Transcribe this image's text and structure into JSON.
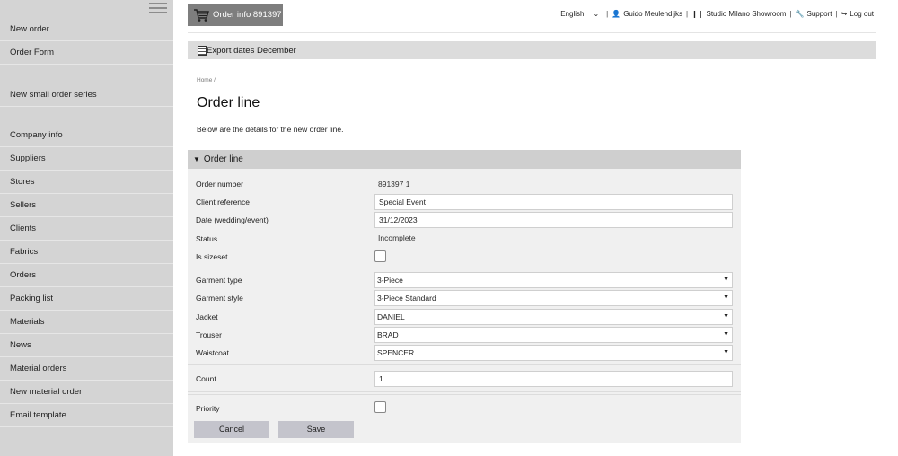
{
  "sidebar": {
    "items": [
      {
        "label": "New order"
      },
      {
        "label": "Order Form"
      },
      {
        "label": "New small order series"
      },
      {
        "label": "Company info"
      },
      {
        "label": "Suppliers"
      },
      {
        "label": "Stores"
      },
      {
        "label": "Sellers"
      },
      {
        "label": "Clients"
      },
      {
        "label": "Fabrics"
      },
      {
        "label": "Orders"
      },
      {
        "label": "Packing list"
      },
      {
        "label": "Materials"
      },
      {
        "label": "News"
      },
      {
        "label": "Material orders"
      },
      {
        "label": "New material order"
      },
      {
        "label": "Email template"
      }
    ]
  },
  "header": {
    "order_info_label": "Order info 891397",
    "language": "English",
    "user": "Guido Meulendijks",
    "showroom": "Studio Milano Showroom",
    "support": "Support",
    "logout": "Log out",
    "export_label": "Export dates December"
  },
  "breadcrumb": "Home /",
  "page_title": "Order line",
  "intro": "Below are the details for the new order line.",
  "form": {
    "section_title": "Order line",
    "order_number": {
      "label": "Order number",
      "value": "891397 1"
    },
    "client_reference": {
      "label": "Client reference",
      "value": "Special Event"
    },
    "date": {
      "label": "Date (wedding/event)",
      "value": "31/12/2023"
    },
    "status": {
      "label": "Status",
      "value": "Incomplete"
    },
    "is_sizeset": {
      "label": "Is sizeset",
      "checked": false
    },
    "garment_type": {
      "label": "Garment type",
      "value": "3-Piece"
    },
    "garment_style": {
      "label": "Garment style",
      "value": "3-Piece Standard"
    },
    "jacket": {
      "label": "Jacket",
      "value": "DANIEL"
    },
    "trouser": {
      "label": "Trouser",
      "value": "BRAD"
    },
    "waistcoat": {
      "label": "Waistcoat",
      "value": "SPENCER"
    },
    "count": {
      "label": "Count",
      "value": "1"
    },
    "priority": {
      "label": "Priority",
      "checked": false
    },
    "cancel_label": "Cancel",
    "save_label": "Save"
  }
}
